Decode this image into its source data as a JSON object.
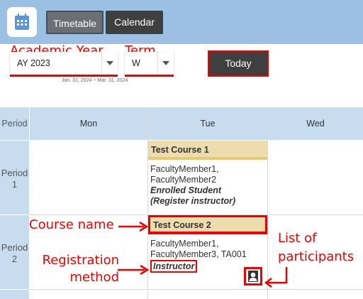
{
  "header": {
    "tabs": [
      {
        "label": "Timetable"
      },
      {
        "label": "Calendar"
      }
    ]
  },
  "controls": {
    "academic_year": {
      "label": "Academic Year",
      "value": "AY 2023"
    },
    "term": {
      "label": "Term",
      "value": "W"
    },
    "date_range": "Jan. 31, 2024 ~ Mar. 31, 2024",
    "today_button": "Today"
  },
  "grid": {
    "period_header": "Period",
    "days": [
      "Mon",
      "Tue",
      "Wed"
    ],
    "periods": [
      {
        "label": "Period\n1"
      },
      {
        "label": "Period\n2"
      }
    ],
    "courses": [
      {
        "title": "Test Course 1",
        "instructors": "FacultyMember1,\nFacultyMember2",
        "registration": "Enrolled Student\n(Register instructor)"
      },
      {
        "title": "Test Course 2",
        "instructors": "FacultyMember1,\nFacultyMember3, TA001",
        "registration": "Instructor"
      }
    ]
  },
  "annotations": {
    "course_name": "Course name",
    "registration_method": "Registration\nmethod",
    "list_of_participants": "List of\nparticipants"
  },
  "colors": {
    "accent_annotation": "#e00000",
    "header_bar": "#9cc0e3",
    "course_header": "#ecdcae"
  }
}
